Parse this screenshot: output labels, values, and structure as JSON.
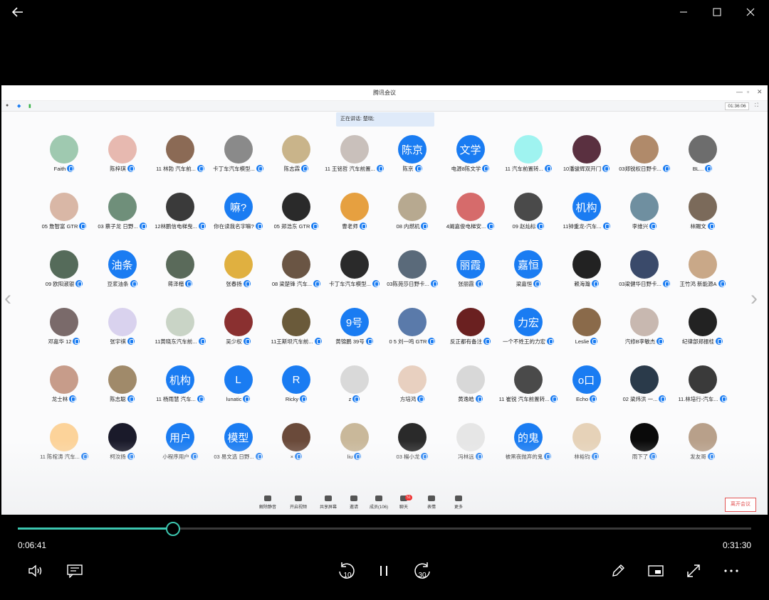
{
  "app": {
    "back_icon": "back-arrow-icon",
    "window_controls": [
      "minimize-icon",
      "maximize-icon",
      "close-icon"
    ]
  },
  "meeting": {
    "title": "腾讯会议",
    "timer": "01:36:06",
    "speaking": "正在讲话: 楚晓;",
    "toolbar": [
      {
        "label": "解除静音",
        "icon": "mic-muted-icon"
      },
      {
        "label": "开启视频",
        "icon": "camera-off-icon"
      },
      {
        "label": "共享屏幕",
        "icon": "share-screen-icon"
      },
      {
        "label": "邀请",
        "icon": "invite-icon"
      },
      {
        "label": "成员(106)",
        "icon": "members-icon"
      },
      {
        "label": "聊天",
        "icon": "chat-icon",
        "badge": "51"
      },
      {
        "label": "表情",
        "icon": "emoji-icon"
      },
      {
        "label": "更多",
        "icon": "more-icon"
      }
    ],
    "leave_label": "离开会议",
    "participants": [
      {
        "name": "Faith",
        "bg": "#9fc9b0"
      },
      {
        "name": "陈梓琪",
        "bg": "#e7b9b0"
      },
      {
        "name": "11 林勃 汽车前...",
        "bg": "#8b6a55"
      },
      {
        "name": "卡丁车汽车模型...",
        "bg": "#8a8a8a"
      },
      {
        "name": "陈志霖",
        "bg": "#c9b48a"
      },
      {
        "name": "11 王铭哲 汽车前置...",
        "bg": "#c9c0bb"
      },
      {
        "name": "陈京",
        "avatar_text": "陈京",
        "bg": "#1a7cf2"
      },
      {
        "name": "电源8陈文学",
        "avatar_text": "文学",
        "bg": "#1a7cf2"
      },
      {
        "name": "11 汽车前置转...",
        "bg": "#9ff3f0"
      },
      {
        "name": "10潘骏辉双开门",
        "bg": "#5a3040"
      },
      {
        "name": "03郑锐权日野卡...",
        "bg": "#b08a6a"
      },
      {
        "name": "BL...",
        "bg": "#6d6d6d"
      },
      {
        "name": "05 詹智富 GTR",
        "bg": "#d9b7a6"
      },
      {
        "name": "03 蔡子龙 日野...",
        "bg": "#6f8f7a"
      },
      {
        "name": "12林鹏信电梯曳...",
        "bg": "#3a3a3a"
      },
      {
        "name": "你在读我名字嘛?",
        "avatar_text": "嘛?",
        "bg": "#1a7cf2"
      },
      {
        "name": "05 郑浩东 GTR",
        "bg": "#2a2a2a"
      },
      {
        "name": "曹老师",
        "bg": "#e6a040"
      },
      {
        "name": "08 内燃机",
        "bg": "#b7a990"
      },
      {
        "name": "4阚嘉俊电梯安...",
        "bg": "#d66b6b"
      },
      {
        "name": "09 赵灿标",
        "bg": "#4a4a4a"
      },
      {
        "name": "11钟重龙-汽车...",
        "avatar_text": "机构",
        "bg": "#1a7cf2"
      },
      {
        "name": "李维兴",
        "bg": "#6f8fa0"
      },
      {
        "name": "林賜文",
        "bg": "#7b6a5a"
      },
      {
        "name": "09 欧阳淑银",
        "bg": "#556b5a"
      },
      {
        "name": "豆浆油条",
        "avatar_text": "油条",
        "bg": "#1a7cf2"
      },
      {
        "name": "蒋泽楷",
        "bg": "#5a6a5a"
      },
      {
        "name": "张春扬",
        "bg": "#e0b040"
      },
      {
        "name": "08 梁楚锋 汽车...",
        "bg": "#6a5544"
      },
      {
        "name": "卡丁车汽车模型...",
        "bg": "#2a2a2a"
      },
      {
        "name": "03陈苑莎日野卡...",
        "bg": "#5a6a7a"
      },
      {
        "name": "张丽霞",
        "avatar_text": "丽霞",
        "bg": "#1a7cf2"
      },
      {
        "name": "梁嘉恒",
        "avatar_text": "嘉恒",
        "bg": "#1a7cf2"
      },
      {
        "name": "赖海瀚",
        "bg": "#222222"
      },
      {
        "name": "03梁健华日野卡...",
        "bg": "#3a4a6a"
      },
      {
        "name": "王竹鸿 新能源A",
        "bg": "#c9a888"
      },
      {
        "name": "邓嘉华 12",
        "bg": "#7a6a6a"
      },
      {
        "name": "张宇祺",
        "bg": "#d9d2ee"
      },
      {
        "name": "11黄晓东汽车前...",
        "bg": "#c9d4c6"
      },
      {
        "name": "吴少权",
        "bg": "#8a3030"
      },
      {
        "name": "11王斯坝汽车前...",
        "bg": "#6a5a3a"
      },
      {
        "name": "黄锦鹏 39号",
        "avatar_text": "9号",
        "bg": "#1a7cf2"
      },
      {
        "name": "0 5 刘一鸣 GTR",
        "bg": "#5a7aaa"
      },
      {
        "name": "反正都有备注",
        "bg": "#6a2020"
      },
      {
        "name": "一个不姓王的力宏",
        "avatar_text": "力宏",
        "bg": "#1a7cf2"
      },
      {
        "name": "Leslie",
        "bg": "#8a6a4a"
      },
      {
        "name": "汽修B李敏杰",
        "bg": "#c8b8b0"
      },
      {
        "name": "纪律部郑振桂",
        "bg": "#222222"
      },
      {
        "name": "龙士林",
        "bg": "#c79c8a"
      },
      {
        "name": "陈志聪",
        "bg": "#a08a6a"
      },
      {
        "name": "11 杨雨慧 汽车...",
        "avatar_text": "机构",
        "bg": "#1a7cf2"
      },
      {
        "name": "lunatic",
        "avatar_text": "L",
        "bg": "#1a7cf2"
      },
      {
        "name": "Ricky",
        "avatar_text": "R",
        "bg": "#1a7cf2"
      },
      {
        "name": "z",
        "bg": "#d9d9d9"
      },
      {
        "name": "方培鸿",
        "bg": "#e8d0c0"
      },
      {
        "name": "黄逸皓",
        "bg": "#d8d8d8"
      },
      {
        "name": "11 崔锐 汽车前置转...",
        "bg": "#4a4a4a"
      },
      {
        "name": "Echo",
        "avatar_text": "o口",
        "bg": "#1a7cf2"
      },
      {
        "name": "02 梁炜洪 一...",
        "bg": "#2a3a4a"
      },
      {
        "name": "11.林培行-汽车...",
        "bg": "#3a3a3a"
      },
      {
        "name": "11 陈棺涛 汽车...",
        "bg": "#fcd39a"
      },
      {
        "name": "柯汝扬",
        "bg": "#1a1a2a"
      },
      {
        "name": "小程序用户",
        "avatar_text": "用户",
        "bg": "#1a7cf2"
      },
      {
        "name": "03 易文选 日野...",
        "avatar_text": "模型",
        "bg": "#1a7cf2"
      },
      {
        "name": "×",
        "bg": "#6a4a3a"
      },
      {
        "name": "liu",
        "bg": "#c9b89a"
      },
      {
        "name": "03 楊小龙",
        "bg": "#2a2a2a"
      },
      {
        "name": "冯林远",
        "bg": "#e6e6e6"
      },
      {
        "name": "被黑夜抛弃的鬼",
        "avatar_text": "的鬼",
        "bg": "#1a7cf2"
      },
      {
        "name": "林裕钧",
        "bg": "#e6d2b8"
      },
      {
        "name": "雨下了",
        "bg": "#0a0a0a"
      },
      {
        "name": "发友哥",
        "bg": "#b8a08a"
      }
    ]
  },
  "player": {
    "current_time": "0:06:41",
    "total_time": "0:31:30",
    "progress": 0.212,
    "accent": "#3cc7b0",
    "controls_left": [
      "volume-icon",
      "subtitles-icon"
    ],
    "controls_center": [
      {
        "icon": "rewind-10-icon",
        "label": "10"
      },
      {
        "icon": "pause-icon",
        "label": ""
      },
      {
        "icon": "forward-30-icon",
        "label": "30"
      }
    ],
    "controls_right": [
      "pen-icon",
      "mini-view-icon",
      "fullscreen-icon",
      "more-icon"
    ]
  }
}
